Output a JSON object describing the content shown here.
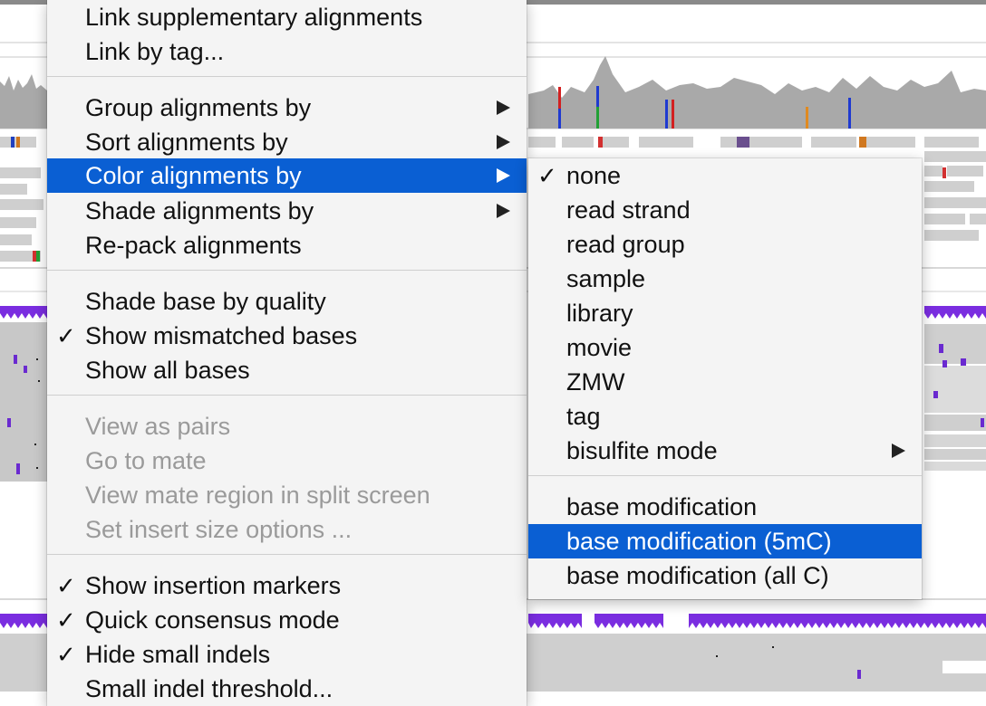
{
  "colors": {
    "highlight": "#0a5fd3",
    "track_gray": "#9a9a9a",
    "modification_purple": "#7a2de0",
    "menu_bg": "#f4f4f4"
  },
  "main_menu": {
    "items": [
      {
        "label": "Link supplementary alignments"
      },
      {
        "label": "Link by tag..."
      },
      {
        "label": "Group alignments by"
      },
      {
        "label": "Sort alignments by"
      },
      {
        "label": "Color alignments by"
      },
      {
        "label": "Shade alignments by"
      },
      {
        "label": "Re-pack alignments"
      },
      {
        "label": "Shade base by quality"
      },
      {
        "label": "Show mismatched bases",
        "check": "✓"
      },
      {
        "label": "Show all bases"
      },
      {
        "label": "View as pairs"
      },
      {
        "label": "Go to mate"
      },
      {
        "label": "View mate region in split screen"
      },
      {
        "label": "Set insert size options ..."
      },
      {
        "label": "Show insertion markers",
        "check": "✓"
      },
      {
        "label": "Quick consensus mode",
        "check": "✓"
      },
      {
        "label": "Hide small indels",
        "check": "✓"
      },
      {
        "label": "Small indel threshold..."
      }
    ]
  },
  "sub_menu": {
    "items": [
      {
        "label": "none",
        "check": "✓"
      },
      {
        "label": "read strand"
      },
      {
        "label": "read group"
      },
      {
        "label": "sample"
      },
      {
        "label": "library"
      },
      {
        "label": "movie"
      },
      {
        "label": "ZMW"
      },
      {
        "label": "tag"
      },
      {
        "label": "bisulfite mode"
      },
      {
        "label": "base modification"
      },
      {
        "label": "base modification (5mC)"
      },
      {
        "label": "base modification (all C)"
      }
    ]
  }
}
